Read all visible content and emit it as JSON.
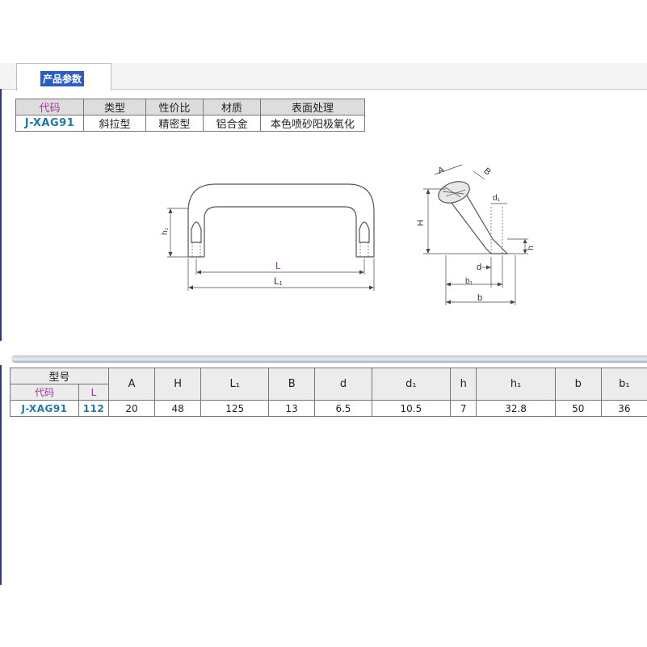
{
  "tab": {
    "label": "产品参数"
  },
  "info_table": {
    "headers": [
      "代码",
      "类型",
      "性价比",
      "材质",
      "表面处理"
    ],
    "row": [
      "J-XAG91",
      "斜拉型",
      "精密型",
      "铝合金",
      "本色喷砂阳极氧化"
    ]
  },
  "drawing": {
    "front": {
      "L": "L",
      "L1": "L₁",
      "h1": "h₁"
    },
    "side": {
      "A": "A",
      "B": "B",
      "H": "H",
      "d1": "d₁",
      "h": "h",
      "d": "d",
      "b1": "b₁",
      "b": "b"
    }
  },
  "spec_table": {
    "model_label": "型号",
    "code_label": "代码",
    "l_label": "L",
    "columns": [
      "A",
      "H",
      "L₁",
      "B",
      "d",
      "d₁",
      "h",
      "h₁",
      "b",
      "b₁"
    ],
    "code": "J-XAG91",
    "l_value": "112",
    "values": [
      "20",
      "48",
      "125",
      "13",
      "6.5",
      "10.5",
      "7",
      "32.8",
      "50",
      "36"
    ]
  }
}
